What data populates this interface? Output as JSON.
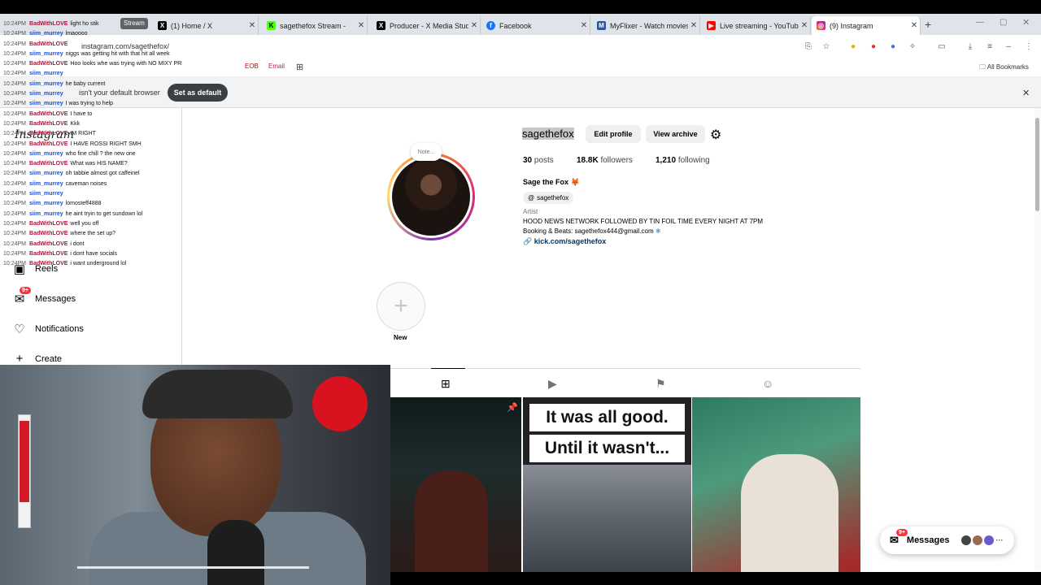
{
  "browser": {
    "tabs": [
      {
        "label": "Stream",
        "favicon": "stream-pill",
        "active": false
      },
      {
        "label": "(1) Home / X",
        "favicon": "x-icon",
        "active": false
      },
      {
        "label": "sagethefox Stream -",
        "favicon": "kick-icon",
        "active": false
      },
      {
        "label": "Producer - X Media Studi",
        "favicon": "x-icon",
        "active": false
      },
      {
        "label": "Facebook",
        "favicon": "facebook-icon",
        "active": false
      },
      {
        "label": "MyFlixer - Watch movies",
        "favicon": "myflixer-icon",
        "active": false
      },
      {
        "label": "Live streaming - YouTub",
        "favicon": "youtube-icon",
        "active": false
      },
      {
        "label": "(9) Instagram",
        "favicon": "instagram-icon",
        "active": true
      }
    ],
    "url": "instagram.com/sagethefox/",
    "bookmarks": {
      "items": [
        "EOB",
        "Email"
      ],
      "all_bookmarks": "All Bookmarks"
    },
    "infobar": {
      "message": "isn't your default browser",
      "button": "Set as default"
    }
  },
  "sidebar": {
    "logo": "Instagram",
    "items": [
      {
        "label": "Reels",
        "icon": "reels-icon"
      },
      {
        "label": "Messages",
        "icon": "messenger-icon",
        "badge": "9+"
      },
      {
        "label": "Notifications",
        "icon": "heart-icon"
      },
      {
        "label": "Create",
        "icon": "plus-icon"
      }
    ]
  },
  "chat_overlay": [
    {
      "ts": "10:24PM",
      "user": "BadWithLOVE",
      "msg": "light ho stik"
    },
    {
      "ts": "10:24PM",
      "user": "siim_murrey",
      "msg": "lmaoooo"
    },
    {
      "ts": "10:24PM",
      "user": "BadWithLOVE",
      "msg": ""
    },
    {
      "ts": "10:24PM",
      "user": "siim_murrey",
      "msg": "niggs was getting hit with that hit all week"
    },
    {
      "ts": "10:24PM",
      "user": "BadWithLOVE",
      "msg": "Hoo looks whe was trying with NO MIXY PREMISES"
    },
    {
      "ts": "10:24PM",
      "user": "siim_murrey",
      "msg": ""
    },
    {
      "ts": "10:24PM",
      "user": "siim_murrey",
      "msg": "he baby current"
    },
    {
      "ts": "10:24PM",
      "user": "siim_murrey",
      "msg": ""
    },
    {
      "ts": "10:24PM",
      "user": "siim_murrey",
      "msg": "I was trying to help"
    },
    {
      "ts": "10:24PM",
      "user": "BadWithLOVE",
      "msg": "I have to"
    },
    {
      "ts": "10:24PM",
      "user": "BadWithLOVE",
      "msg": "Kkk"
    },
    {
      "ts": "10:24PM",
      "user": "BadWithLOVE",
      "msg": "IM RIGHT"
    },
    {
      "ts": "10:24PM",
      "user": "BadWithLOVE",
      "msg": "I HAVE ROSSI RIGHT SMH"
    },
    {
      "ts": "10:24PM",
      "user": "siim_murrey",
      "msg": "who fine chill ? the new one"
    },
    {
      "ts": "10:24PM",
      "user": "BadWithLOVE",
      "msg": "What was HIS NAME?"
    },
    {
      "ts": "10:24PM",
      "user": "siim_murrey",
      "msg": "oh tabbie almost got caffeinel"
    },
    {
      "ts": "10:24PM",
      "user": "siim_murrey",
      "msg": "caveman noises"
    },
    {
      "ts": "10:24PM",
      "user": "siim_murrey",
      "msg": ""
    },
    {
      "ts": "10:24PM",
      "user": "siim_murrey",
      "msg": "lomosteff4888"
    },
    {
      "ts": "10:24PM",
      "user": "siim_murrey",
      "msg": "he aint tryin to get sundown lol"
    },
    {
      "ts": "10:24PM",
      "user": "BadWithLOVE",
      "msg": "well you off"
    },
    {
      "ts": "10:24PM",
      "user": "BadWithLOVE",
      "msg": "where the set up?"
    },
    {
      "ts": "10:24PM",
      "user": "BadWithLOVE",
      "msg": "i dont"
    },
    {
      "ts": "10:24PM",
      "user": "BadWithLOVE",
      "msg": "i dont have socials"
    },
    {
      "ts": "10:24PM",
      "user": "BadWithLOVE",
      "msg": "i want underground lol"
    }
  ],
  "profile": {
    "username": "sagethefox",
    "note": "Note...",
    "edit_profile": "Edit profile",
    "view_archive": "View archive",
    "stats": {
      "posts_count": "30",
      "posts_label": "posts",
      "followers_count": "18.8K",
      "followers_label": "followers",
      "following_count": "1,210",
      "following_label": "following"
    },
    "display_name": "Sage the Fox",
    "threads_handle": "sagethefox",
    "category": "Artist",
    "bio_line1": "HOOD NEWS NETWORK FOLLOWED BY TIN FOIL TIME EVERY NIGHT AT 7PM",
    "bio_line2": "Booking & Beats: sagethefox444@gmail.com",
    "link": "kick.com/sagethefox",
    "new_highlight": "New"
  },
  "posts": {
    "post2_line1": "It was all good.",
    "post2_line2": "Until it wasn't..."
  },
  "messages_widget": {
    "label": "Messages",
    "badge": "9+"
  },
  "colors": {
    "instagram_link": "#00376b",
    "badge_red": "#ff3040",
    "stream_red": "#d8131f"
  }
}
